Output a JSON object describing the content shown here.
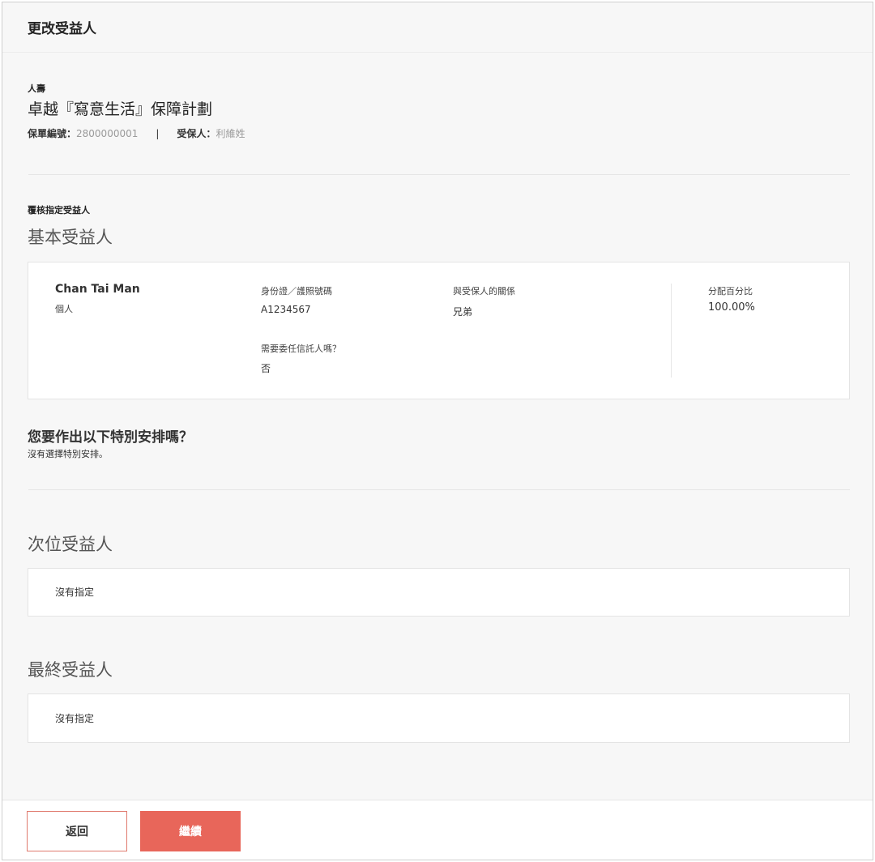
{
  "header": {
    "title": "更改受益人"
  },
  "policy": {
    "category": "人壽",
    "plan_name": "卓越『寫意生活』保障計劃",
    "policy_no_label": "保單編號：",
    "policy_no_value": "2800000001",
    "separator": "|",
    "insured_label": "受保人：",
    "insured_value": "利維姓"
  },
  "review": {
    "heading": "覆核指定受益人",
    "primary_title": "基本受益人",
    "primary": {
      "name": "Chan Tai Man",
      "type": "個人",
      "id_label": "身份證／護照號碼",
      "id_value": "A1234567",
      "relation_label": "與受保人的關係",
      "relation_value": "兄弟",
      "trustee_label": "需要委任信託人嗎？",
      "trustee_value": "否",
      "share_label": "分配百分比",
      "share_value": "100.00%"
    }
  },
  "special": {
    "question": "您要作出以下特別安排嗎？",
    "answer": "沒有選擇特別安排。"
  },
  "secondary": {
    "title": "次位受益人",
    "empty": "沒有指定"
  },
  "final": {
    "title": "最終受益人",
    "empty": "沒有指定"
  },
  "footer": {
    "back_label": "返回",
    "continue_label": "繼續"
  },
  "colors": {
    "accent": "#e8665a",
    "border_accent": "#e07a6e"
  }
}
